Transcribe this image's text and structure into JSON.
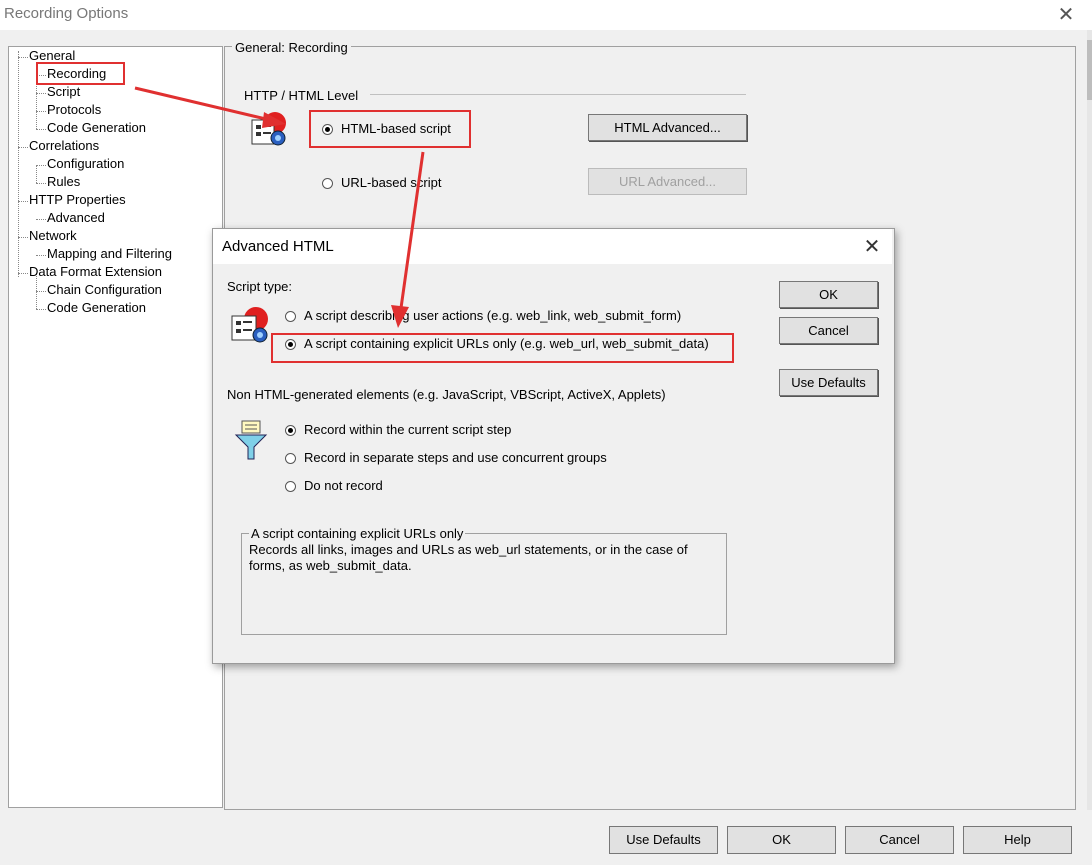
{
  "window": {
    "title": "Recording Options",
    "close_glyph": "✕"
  },
  "tree": {
    "general": "General",
    "recording": "Recording",
    "script": "Script",
    "protocols": "Protocols",
    "code_generation_1": "Code Generation",
    "correlations": "Correlations",
    "configuration": "Configuration",
    "rules": "Rules",
    "http_properties": "HTTP Properties",
    "advanced": "Advanced",
    "network": "Network",
    "mapping_filtering": "Mapping and Filtering",
    "data_format_extension": "Data Format Extension",
    "chain_configuration": "Chain Configuration",
    "code_generation_2": "Code Generation"
  },
  "panel": {
    "title": "General: Recording",
    "http_level_label": "HTTP / HTML Level",
    "html_based_label": "HTML-based script",
    "url_based_label": "URL-based script",
    "html_advanced_button": "HTML Advanced...",
    "url_advanced_button": "URL Advanced...",
    "html_based_checked": true
  },
  "dialog": {
    "title": "Advanced HTML",
    "close_glyph": "✕",
    "script_type_label": "Script type:",
    "option_user_actions": "A script describing user actions (e.g. web_link, web_submit_form)",
    "option_explicit_urls": "A script containing explicit URLs only (e.g. web_url, web_submit_data)",
    "non_html_label": "Non HTML-generated elements (e.g. JavaScript, VBScript, ActiveX, Applets)",
    "option_current_step": "Record within the current script step",
    "option_separate_steps": "Record in separate steps and use concurrent groups",
    "option_do_not_record": "Do not record",
    "ok_button": "OK",
    "cancel_button": "Cancel",
    "use_defaults_button": "Use Defaults",
    "description_title": "A script containing explicit URLs only",
    "description_text": "Records all links, images and URLs as web_url statements, or in the case of forms, as web_submit_data."
  },
  "footer": {
    "use_defaults": "Use Defaults",
    "ok": "OK",
    "cancel": "Cancel",
    "help": "Help"
  },
  "colors": {
    "highlight_red": "#e03030",
    "window_bg": "#f0f0f0"
  }
}
